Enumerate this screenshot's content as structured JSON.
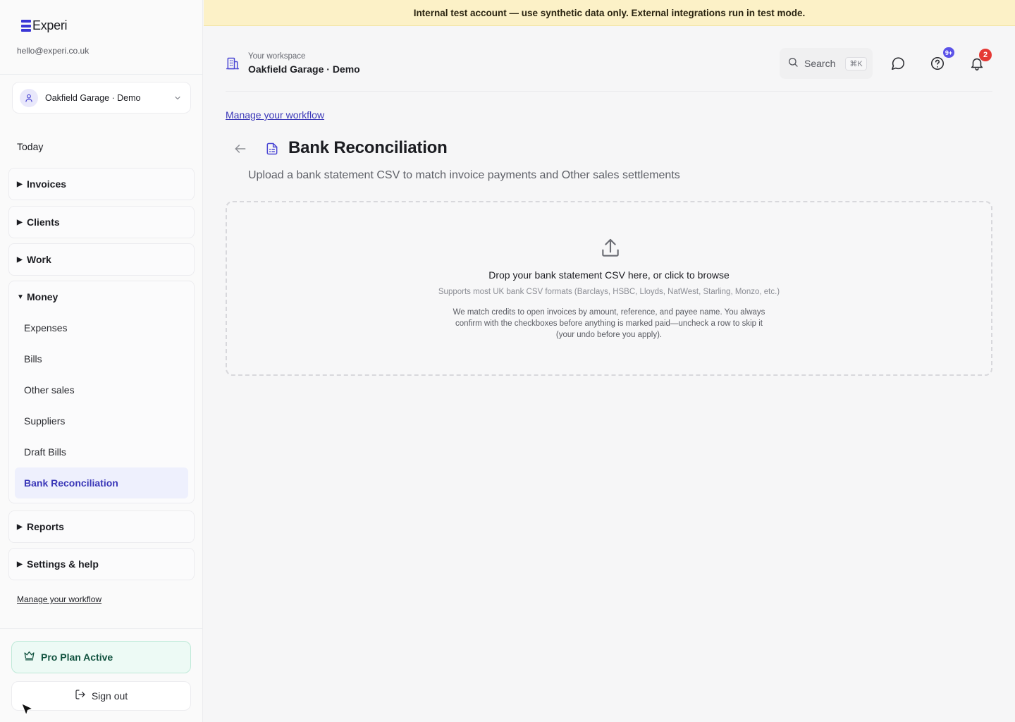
{
  "app": {
    "name": "Experi",
    "user_email": "hello@experi.co.uk"
  },
  "workspace": {
    "switcher_name": "Oakfield Garage · Demo"
  },
  "sidebar": {
    "today_label": "Today",
    "groups": [
      {
        "label": "Invoices",
        "expanded": false
      },
      {
        "label": "Clients",
        "expanded": false
      },
      {
        "label": "Work",
        "expanded": false
      },
      {
        "label": "Money",
        "expanded": true,
        "items": [
          {
            "label": "Expenses"
          },
          {
            "label": "Bills"
          },
          {
            "label": "Other sales"
          },
          {
            "label": "Suppliers"
          },
          {
            "label": "Draft Bills"
          },
          {
            "label": "Bank Reconciliation",
            "active": true
          }
        ]
      },
      {
        "label": "Reports",
        "expanded": false
      },
      {
        "label": "Settings & help",
        "expanded": false
      }
    ],
    "workflow_link": "Manage your workflow",
    "plan_label": "Pro Plan Active",
    "sign_out_label": "Sign out",
    "collapsed_marker": "▶",
    "expanded_marker": "▼"
  },
  "banner": {
    "text": "Internal test account — use synthetic data only. External integrations run in test mode."
  },
  "topbar": {
    "caption": "Your workspace",
    "title": "Oakfield Garage · Demo",
    "search_label": "Search",
    "search_shortcut": "⌘K",
    "help_badge": "9+",
    "notifications_badge": "2"
  },
  "page": {
    "workflow_link": "Manage your workflow",
    "title": "Bank Reconciliation",
    "subtitle": "Upload a bank statement CSV to match invoice payments and Other sales settlements",
    "dropzone": {
      "title": "Drop your bank statement CSV here, or click to browse",
      "formats": "Supports most UK bank CSV formats (Barclays, HSBC, Lloyds, NatWest, Starling, Monzo, etc.)",
      "note": "We match credits to open invoices by amount, reference, and payee name. You always confirm with the checkboxes before anything is marked paid—uncheck a row to skip it (your undo before you apply)."
    }
  },
  "colors": {
    "brand": "#3b37d6",
    "active_bg": "#eef0fd",
    "active_text": "#3a37b8",
    "banner_bg": "#fcf1c7",
    "plan_bg": "#edfaf5",
    "plan_text": "#11523f",
    "badge_help": "#5b52e8",
    "badge_notif": "#e53935"
  }
}
